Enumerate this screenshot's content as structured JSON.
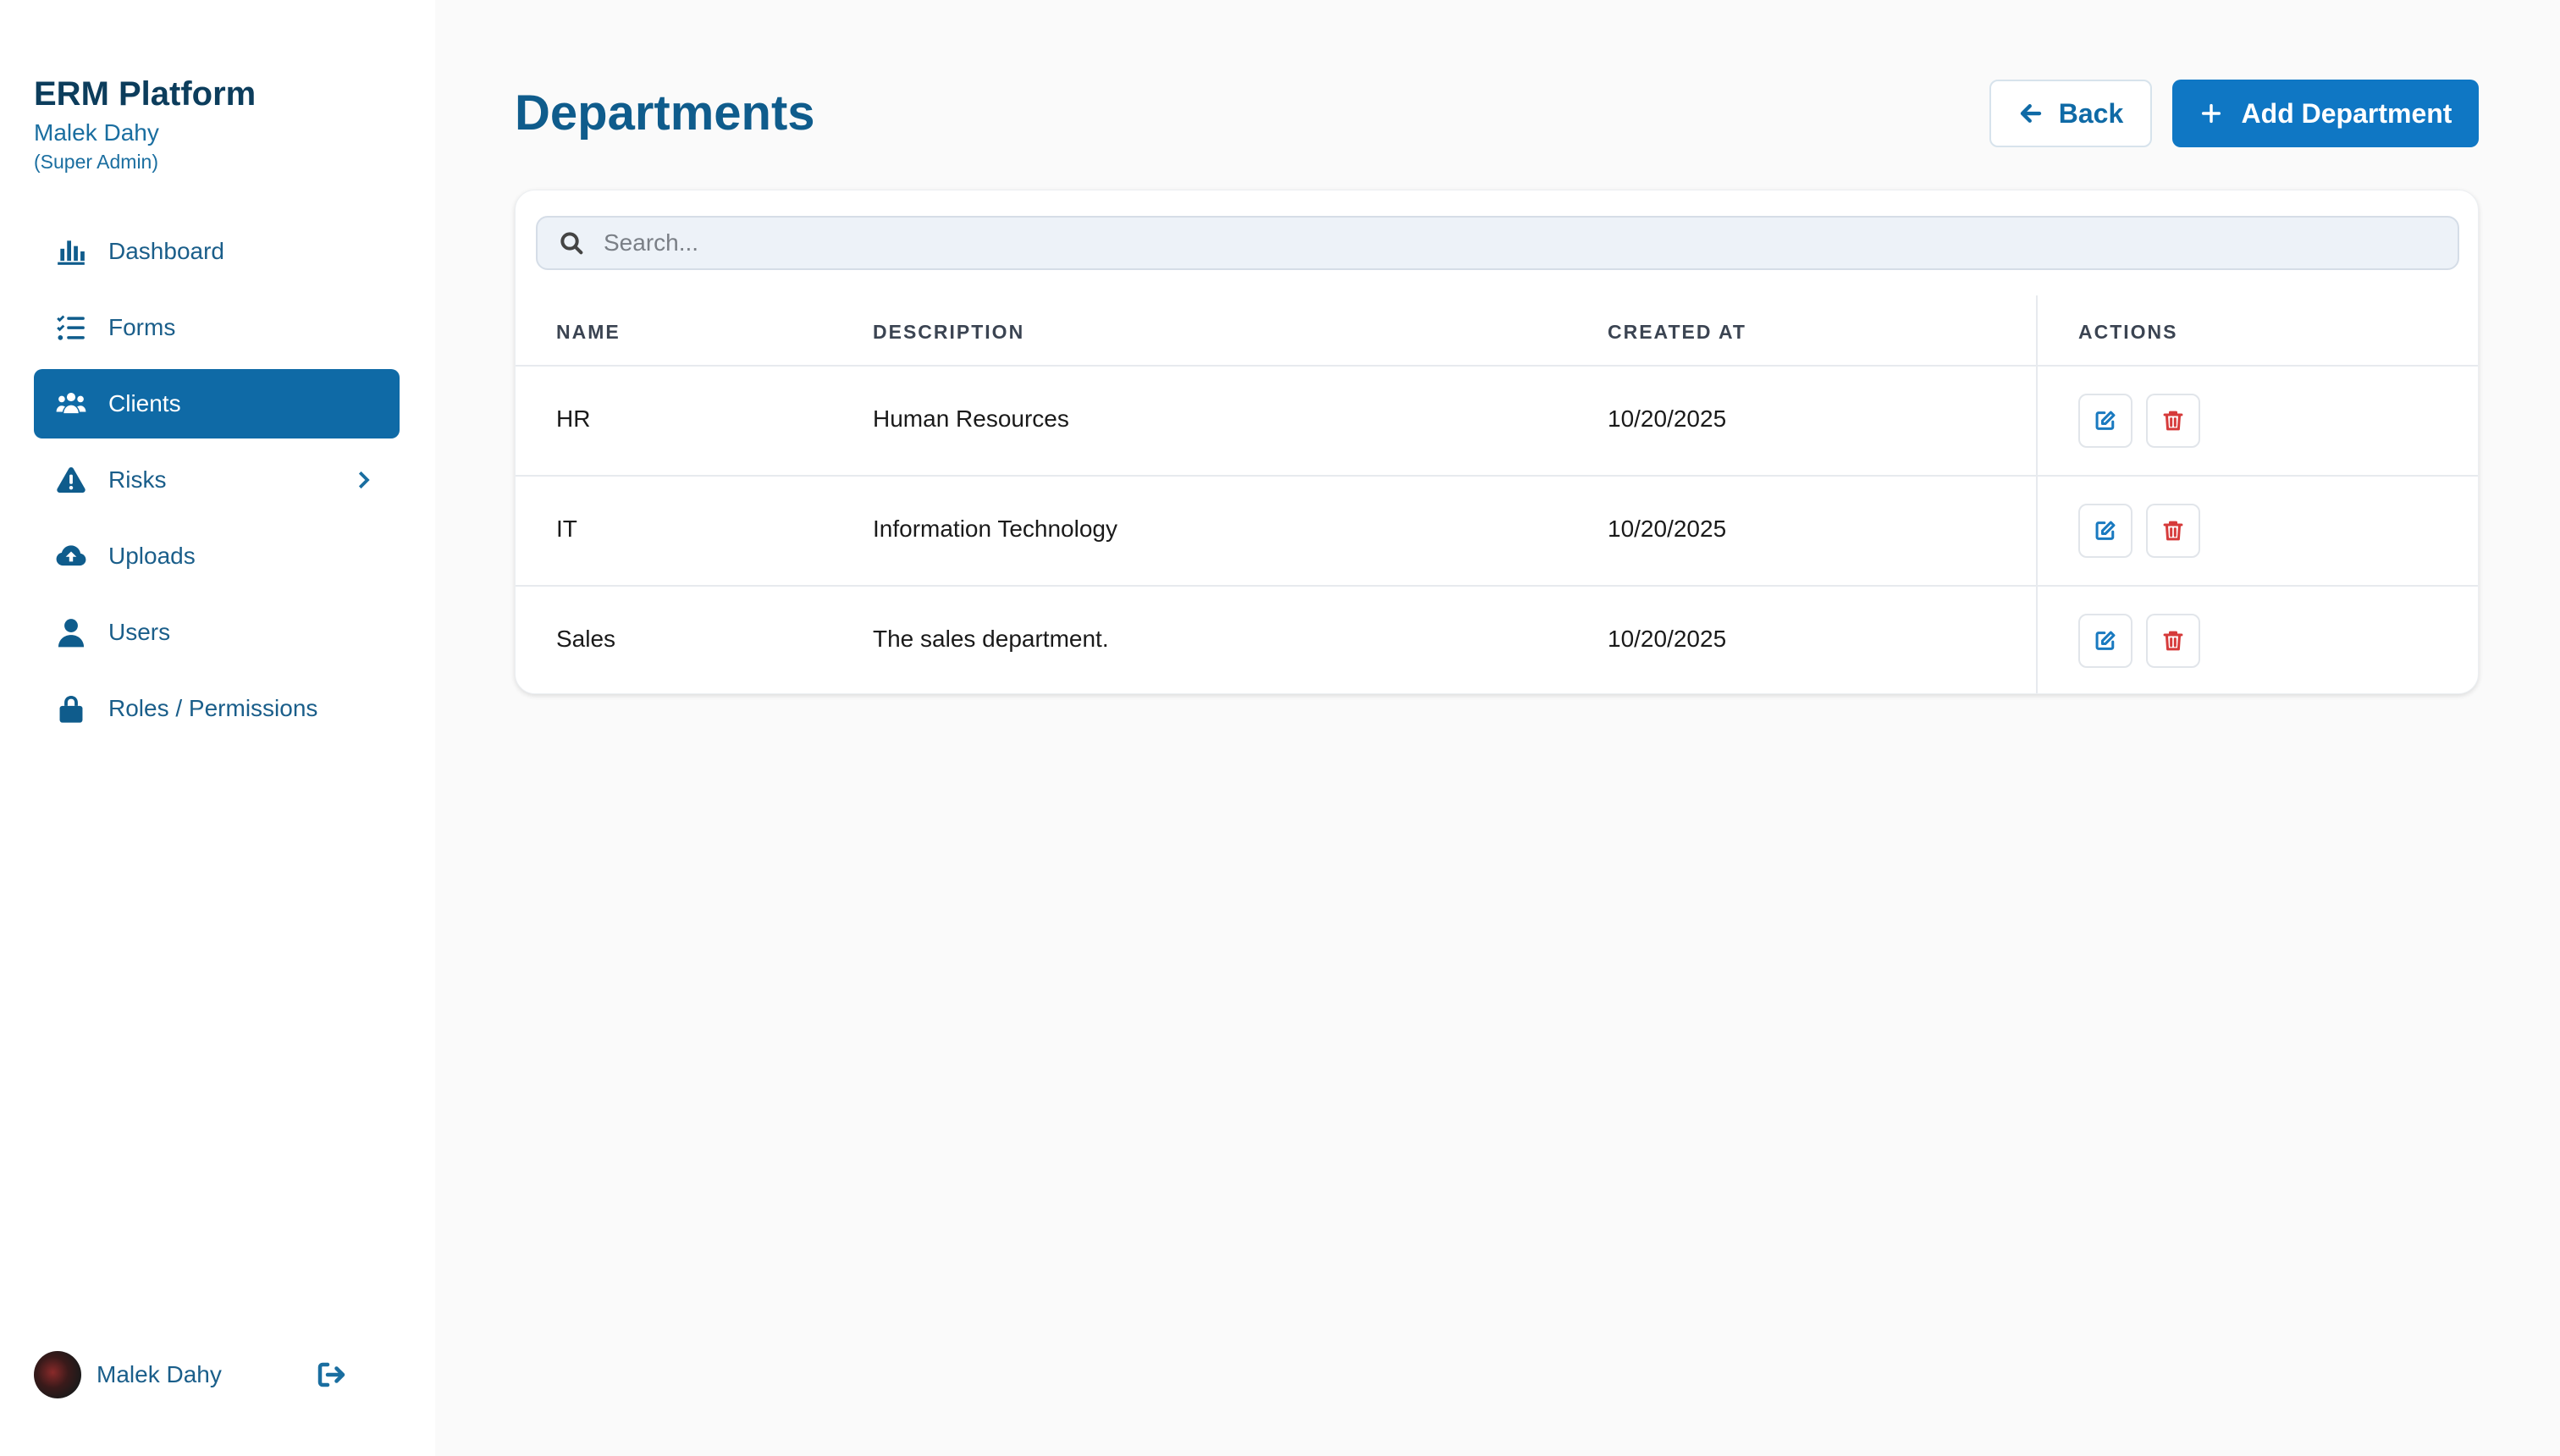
{
  "sidebar": {
    "brand_title": "ERM Platform",
    "user_name": "Malek Dahy",
    "user_role": "(Super Admin)",
    "items": [
      {
        "label": "Dashboard",
        "icon": "bar-chart-icon"
      },
      {
        "label": "Forms",
        "icon": "checklist-icon"
      },
      {
        "label": "Clients",
        "icon": "users-group-icon",
        "active": true
      },
      {
        "label": "Risks",
        "icon": "warning-icon",
        "has_submenu": true
      },
      {
        "label": "Uploads",
        "icon": "cloud-upload-icon"
      },
      {
        "label": "Users",
        "icon": "user-icon"
      },
      {
        "label": "Roles / Permissions",
        "icon": "lock-icon"
      }
    ],
    "footer_name": "Malek Dahy"
  },
  "header": {
    "title": "Departments",
    "back_label": "Back",
    "add_label": "Add Department"
  },
  "search": {
    "placeholder": "Search..."
  },
  "table": {
    "columns": [
      "NAME",
      "DESCRIPTION",
      "CREATED AT",
      "ACTIONS"
    ],
    "rows": [
      {
        "name": "HR",
        "description": "Human Resources",
        "created_at": "10/20/2025"
      },
      {
        "name": "IT",
        "description": "Information Technology",
        "created_at": "10/20/2025"
      },
      {
        "name": "Sales",
        "description": "The sales department.",
        "created_at": "10/20/2025"
      }
    ]
  },
  "colors": {
    "primary": "#0f77c4",
    "sidebar_active": "#0f6aa6",
    "title": "#0f5c8c",
    "delete": "#d63b3b"
  }
}
